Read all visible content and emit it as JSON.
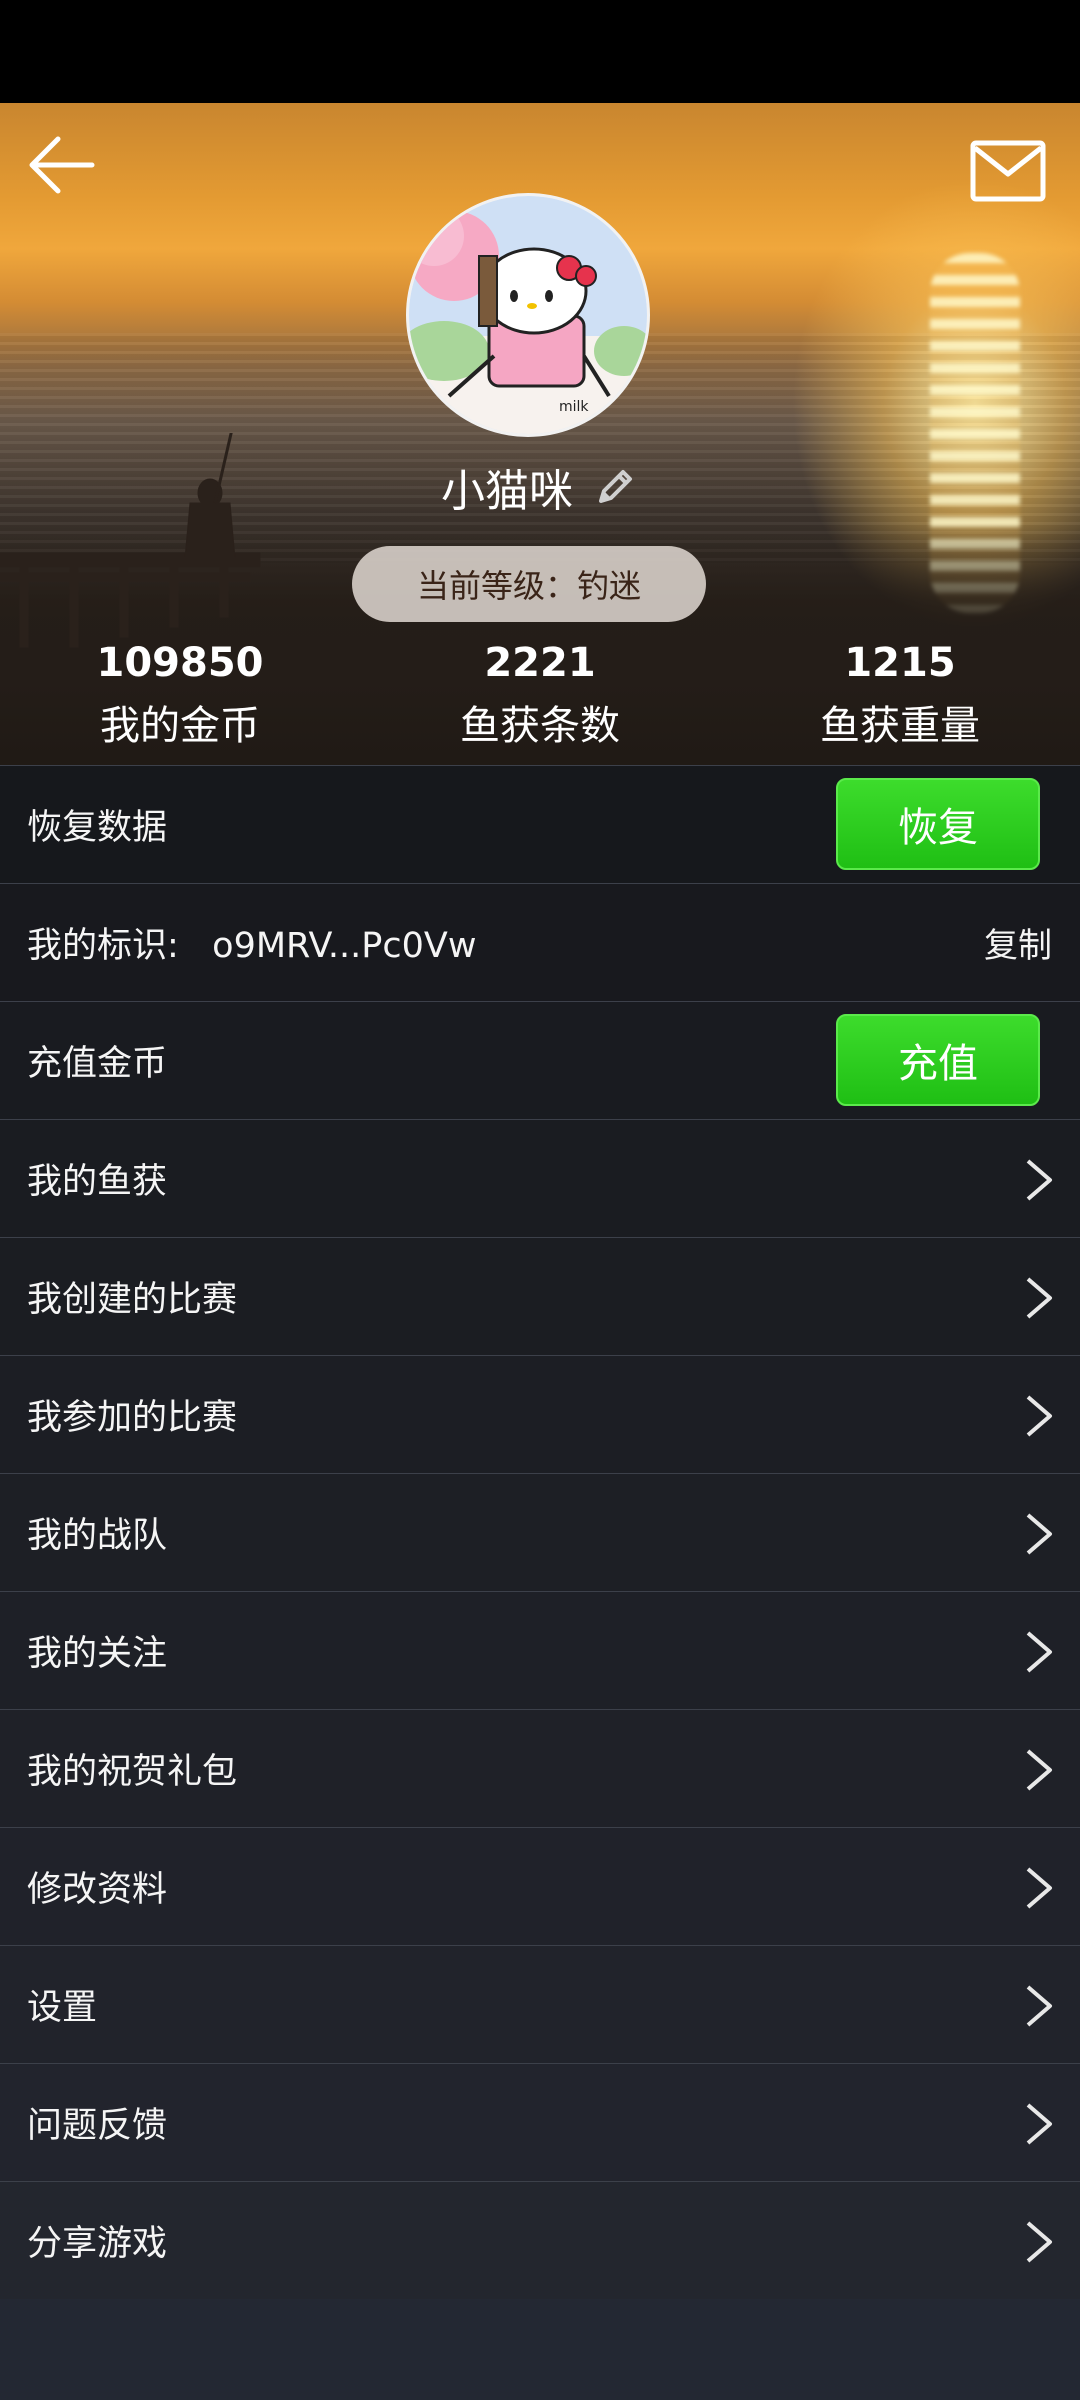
{
  "profile": {
    "username": "小猫咪",
    "level_text": "当前等级：钓迷"
  },
  "stats": [
    {
      "value": "109850",
      "label": "我的金币"
    },
    {
      "value": "2221",
      "label": "鱼获条数"
    },
    {
      "value": "1215",
      "label": "鱼获重量"
    }
  ],
  "rows": {
    "restore": {
      "label": "恢复数据",
      "button": "恢复"
    },
    "identity": {
      "label": "我的标识:   o9MRV...Pc0Vw",
      "button": "复制"
    },
    "recharge": {
      "label": "充值金币",
      "button": "充值"
    },
    "menu": [
      "我的鱼获",
      "我创建的比赛",
      "我参加的比赛",
      "我的战队",
      "我的关注",
      "我的祝贺礼包",
      "修改资料",
      "设置",
      "问题反馈",
      "分享游戏"
    ]
  },
  "icons": {
    "back": "arrow-left-icon",
    "mail": "mail-icon",
    "edit": "pencil-icon",
    "chevron": "chevron-right-icon"
  },
  "colors": {
    "accent_green": "#22c418",
    "background": "#232833"
  }
}
